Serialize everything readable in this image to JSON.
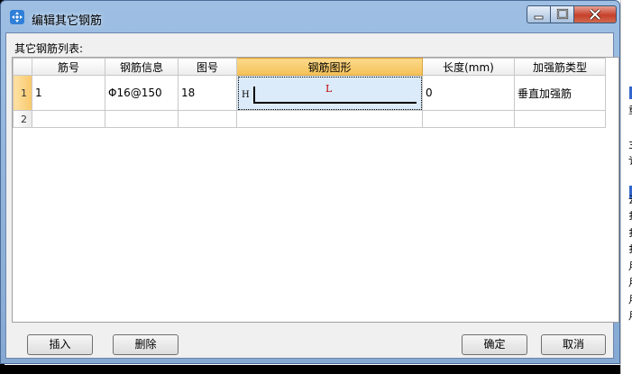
{
  "window": {
    "title": "编辑其它钢筋"
  },
  "list_label": "其它钢筋列表:",
  "table": {
    "columns": [
      "筋号",
      "钢筋信息",
      "图号",
      "钢筋图形",
      "长度(mm)",
      "加强筋类型"
    ],
    "rows": [
      {
        "index": "1",
        "bar_no": "1",
        "bar_info": "Φ16@150",
        "shape_no": "18",
        "shape_h": "H",
        "shape_l": "L",
        "length": "0",
        "type": "垂直加强筋"
      },
      {
        "index": "2",
        "bar_no": "",
        "bar_info": "",
        "shape_no": "",
        "shape_h": "",
        "shape_l": "",
        "length": "",
        "type": ""
      }
    ]
  },
  "buttons": {
    "insert": "插入",
    "delete": "删除",
    "ok": "确定",
    "cancel": "取消"
  },
  "background_fragments": [
    "重",
    "3",
    "讠",
    "云",
    "扌",
    "扌",
    "扌",
    "月",
    "月",
    "月",
    "月"
  ]
}
